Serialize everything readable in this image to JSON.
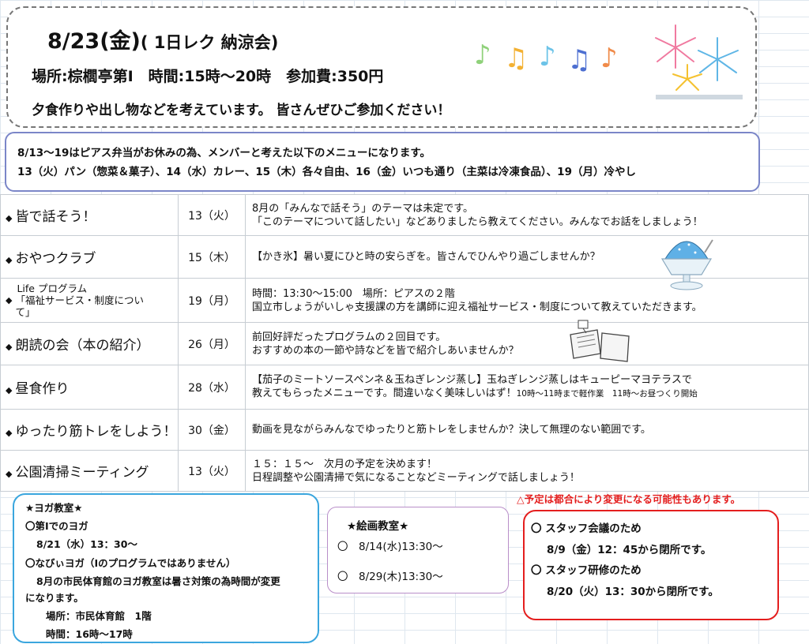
{
  "event": {
    "title_date": "8/23(金)",
    "title_sub": "( 1日レク 納涼会)",
    "details": "場所:棕櫚亭第Ⅰ　時間:15時～20時　参加費:350円",
    "note": "夕食作りや出し物などを考えています。 皆さんぜひご参加ください！"
  },
  "menu_notice": {
    "line1": "8/13～19はピアス弁当がお休みの為、メンバーと考えた以下のメニューになります。",
    "line2": "13（火）パン（惣菜＆菓子）、14（水）カレー、15（木）各々自由、16（金）いつも通り（主菜は冷凍食品）、19（月）冷やし"
  },
  "schedule": [
    {
      "name": "皆で話そう！",
      "date": "13（火）",
      "desc1": "8月の「みんなで話そう」のテーマは未定です。",
      "desc2": "「このテーマについて話したい」などありましたら教えてください。みんなでお話をしましょう！"
    },
    {
      "name": "おやつクラブ",
      "date": "15（木）",
      "desc1": "【かき氷】暑い夏にひと時の安らぎを。皆さんでひんやり過ごしませんか？",
      "desc2": ""
    },
    {
      "name_line1": "Life プログラム",
      "name_line2": "「福祉サービス・制度につい",
      "name_line3": "て」",
      "date": "19（月）",
      "desc1": "時間：13:30～15:00　場所：ピアスの２階",
      "desc2": "国立市しょうがいしゃ支援課の方を講師に迎え福祉サービス・制度について教えていただきます。"
    },
    {
      "name": "朗読の会（本の紹介）",
      "date": "26（月）",
      "desc1": "前回好評だったプログラムの２回目です。",
      "desc2": "おすすめの本の一節や詩などを皆で紹介しあいませんか？"
    },
    {
      "name": "昼食作り",
      "date": "28（水）",
      "desc1": "【茄子のミートソースペンネ＆玉ねぎレンジ蒸し】玉ねぎレンジ蒸しはキューピーマヨテラスで",
      "desc2": "教えてもらったメニューです。間違いなく美味しいはず！",
      "desc2_small": "10時～11時まで軽作業　11時～お昼つくり開始"
    },
    {
      "name": "ゆったり筋トレをしよう！",
      "date": "30（金）",
      "desc1": "動画を見ながらみんなでゆったりと筋トレをしませんか？決して無理のない範囲です。",
      "desc2": ""
    },
    {
      "name": "公園清掃ミーティング",
      "date": "13（火）",
      "desc1": "１５：１５～　次月の予定を決めます！",
      "desc2": "日程調整や公園清掃で気になることなどミーティングで話しましょう！"
    }
  ],
  "yoga": {
    "title": "★ヨガ教室★",
    "l1": "〇第Ⅰでのヨガ",
    "l2": "8/21（水）13：30～",
    "l3": "〇なびぃヨガ（Ⅰのプログラムではありません）",
    "l4": "8月の市民体育館のヨガ教室は暑さ対策の為時間が変更",
    "l5": "になります。",
    "l6": "場所：市民体育館　1階",
    "l7": "時間：16時～17時"
  },
  "painting": {
    "title": "★絵画教室★",
    "l1": "〇　8/14(水)13:30～",
    "l2": "〇　8/29(木)13:30～"
  },
  "warning": "△予定は都合により変更になる可能性もあります。",
  "staff": {
    "l1": "〇 スタッフ会議のため",
    "l2": "8/9（金）12：45から閉所です。",
    "l3": "〇 スタッフ研修のため",
    "l4": "8/20（火）13：30から閉所です。"
  },
  "bullet_glyph": "◆",
  "icons": {
    "music_notes": "music-notes-icon",
    "fireworks": "fireworks-icon",
    "shaved_ice": "shaved-ice-icon",
    "books": "books-icon"
  },
  "colors": {
    "menu_border": "#7b86c8",
    "yoga_border": "#3aa6de",
    "painting_border": "#b98ec9",
    "staff_border": "#e41e1e",
    "warning": "#e41e1e"
  }
}
